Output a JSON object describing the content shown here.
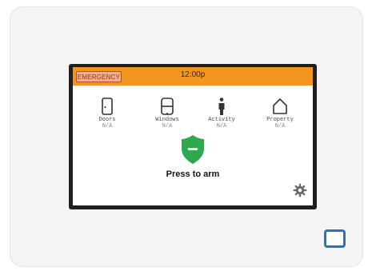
{
  "topbar": {
    "emergency_label": "EMERGENCY",
    "time": "12:00p",
    "color": "#f3961f"
  },
  "tiles": [
    {
      "label": "Doors",
      "value": "N/A",
      "icon": "door-icon"
    },
    {
      "label": "Windows",
      "value": "N/A",
      "icon": "window-icon"
    },
    {
      "label": "Activity",
      "value": "N/A",
      "icon": "person-icon"
    },
    {
      "label": "Property",
      "value": "N/A",
      "icon": "house-icon"
    }
  ],
  "arm": {
    "label": "Press to arm",
    "icon": "shield-icon",
    "color": "#2fa84f"
  },
  "settings": {
    "icon": "gear-icon"
  },
  "device": {
    "home_button_icon": "home-button",
    "accent": "#2f71b9"
  }
}
